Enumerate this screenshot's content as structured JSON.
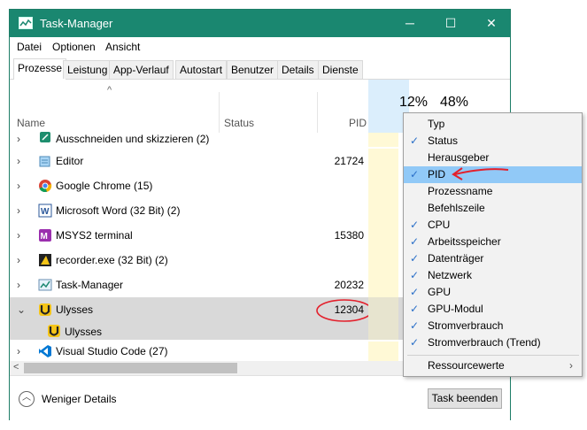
{
  "window": {
    "title": "Task-Manager",
    "minimize": "─",
    "maximize": "☐",
    "close": "✕"
  },
  "menu": [
    "Datei",
    "Optionen",
    "Ansicht"
  ],
  "tabs": [
    "Prozesse",
    "Leistung",
    "App-Verlauf",
    "Autostart",
    "Benutzer",
    "Details",
    "Dienste"
  ],
  "header": {
    "name": "Name",
    "status": "Status",
    "pid": "PID",
    "cpu_percent": "12%",
    "mem_percent": "48%",
    "sort_arrow": "^"
  },
  "processes": [
    {
      "name": "Ausschneiden und skizzieren (2)",
      "pid": "",
      "chevron": "›",
      "icon": "snip-icon"
    },
    {
      "name": "Editor",
      "pid": "21724",
      "chevron": "›",
      "icon": "notepad-icon"
    },
    {
      "name": "Google Chrome (15)",
      "pid": "",
      "chevron": "›",
      "icon": "chrome-icon"
    },
    {
      "name": "Microsoft Word (32 Bit) (2)",
      "pid": "",
      "chevron": "›",
      "icon": "word-icon"
    },
    {
      "name": "MSYS2 terminal",
      "pid": "15380",
      "chevron": "›",
      "icon": "msys2-icon"
    },
    {
      "name": "recorder.exe (32 Bit) (2)",
      "pid": "",
      "chevron": "›",
      "icon": "recorder-icon"
    },
    {
      "name": "Task-Manager",
      "pid": "20232",
      "chevron": "›",
      "icon": "taskmanager-icon"
    },
    {
      "name": "Ulysses",
      "pid": "12304",
      "chevron": "⌄",
      "icon": "ulysses-icon",
      "selected": true
    },
    {
      "name": "Ulysses",
      "pid": "",
      "chevron": "",
      "icon": "ulysses-icon",
      "child": true
    },
    {
      "name": "Visual Studio Code (27)",
      "pid": "",
      "chevron": "›",
      "icon": "vscode-icon"
    }
  ],
  "footer": {
    "fewer_details": "Weniger Details",
    "end_task": "Task beenden"
  },
  "context_menu": [
    {
      "label": "Typ",
      "checked": false
    },
    {
      "label": "Status",
      "checked": true
    },
    {
      "label": "Herausgeber",
      "checked": false
    },
    {
      "label": "PID",
      "checked": true,
      "highlighted": true
    },
    {
      "label": "Prozessname",
      "checked": false
    },
    {
      "label": "Befehlszeile",
      "checked": false
    },
    {
      "label": "CPU",
      "checked": true
    },
    {
      "label": "Arbeitsspeicher",
      "checked": true
    },
    {
      "label": "Datenträger",
      "checked": true
    },
    {
      "label": "Netzwerk",
      "checked": true
    },
    {
      "label": "GPU",
      "checked": true
    },
    {
      "label": "GPU-Modul",
      "checked": true
    },
    {
      "label": "Stromverbrauch",
      "checked": true
    },
    {
      "label": "Stromverbrauch (Trend)",
      "checked": true
    }
  ],
  "context_menu_sub": {
    "label": "Ressourcewerte",
    "arrow": "›"
  },
  "check_glyph": "✓",
  "colors": {
    "titlebar": "#1a8770",
    "highlight": "#91c9f7",
    "annotation": "#e3202c",
    "cpu_column": "#fff9d6"
  }
}
